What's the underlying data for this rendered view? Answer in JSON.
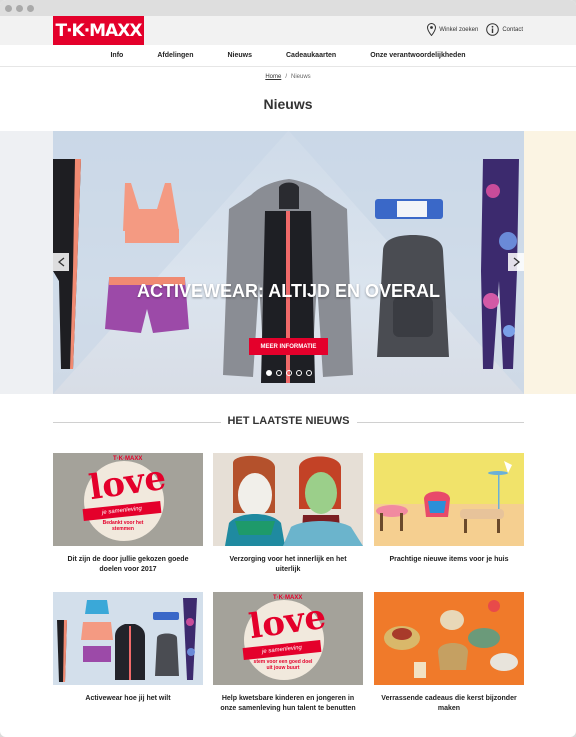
{
  "brand": {
    "logo_text": "T·K·MAXX",
    "color": "#e4002b"
  },
  "header": {
    "links": [
      {
        "label": "Winkel zoeken",
        "icon": "map-pin-icon"
      },
      {
        "label": "Contact",
        "icon": "info-icon"
      }
    ]
  },
  "nav": {
    "items": [
      "Info",
      "Afdelingen",
      "Nieuws",
      "Cadeaukaarten",
      "Onze verantwoordelijkheden"
    ]
  },
  "breadcrumb": {
    "home": "Home",
    "separator": "/",
    "current": "Nieuws"
  },
  "page_title": "Nieuws",
  "hero": {
    "title": "ACTIVEWEAR: ALTIJD EN OVERAL",
    "button_label": "MEER INFORMATIE",
    "slide_count": 5,
    "active_slide": 1
  },
  "latest": {
    "heading": "HET LAATSTE NIEUWS",
    "cards": [
      {
        "caption": "Dit zijn de door jullie gekozen goede doelen voor 2017",
        "image": "love-campaign-thanks"
      },
      {
        "caption": "Verzorging voor het innerlijk en het uiterlijk",
        "image": "face-masks"
      },
      {
        "caption": "Prachtige nieuwe items voor je huis",
        "image": "home-items"
      },
      {
        "caption": "Activewear hoe jij het wilt",
        "image": "activewear"
      },
      {
        "caption": "Help kwetsbare kinderen en jongeren in onze samenleving hun talent te benutten",
        "image": "love-campaign-vote"
      },
      {
        "caption": "Verrassende cadeaus die kerst bijzonder maken",
        "image": "christmas-gifts"
      }
    ],
    "love_card_1": {
      "brand": "T·K·MAXX",
      "word": "love",
      "ribbon": "je samenleving",
      "sub": "Bedankt voor het stemmen"
    },
    "love_card_2": {
      "brand": "T·K·MAXX",
      "word": "love",
      "ribbon": "je samenleving",
      "sub": "stem voor een goed doel uit jouw buurt"
    }
  }
}
